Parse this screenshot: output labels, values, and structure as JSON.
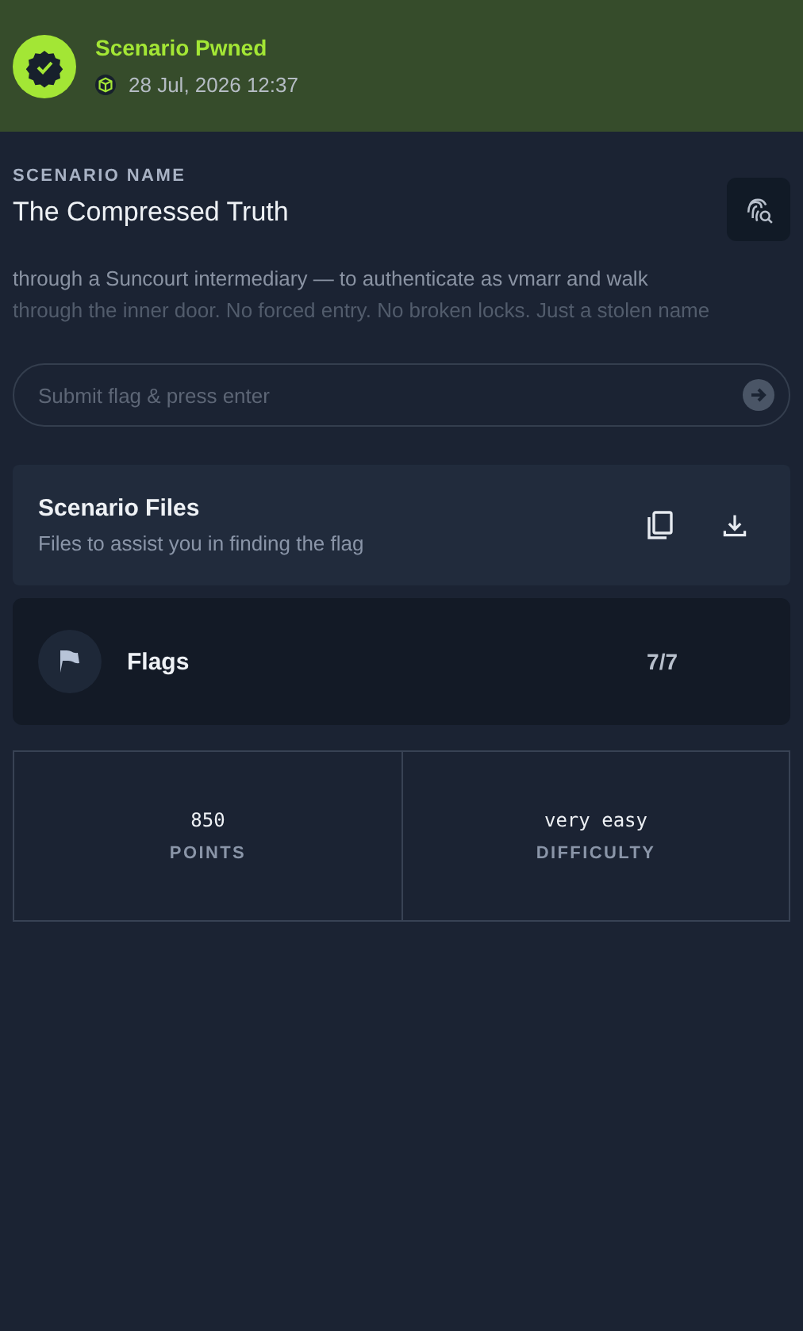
{
  "status_banner": {
    "title": "Scenario Pwned",
    "date": "28 Jul, 2026 12:37"
  },
  "scenario": {
    "label": "SCENARIO NAME",
    "name": "The Compressed Truth",
    "description_lines": [
      "through a Suncourt intermediary — to authenticate as vmarr and walk",
      "through the inner door. No forced entry. No broken locks. Just a stolen name"
    ]
  },
  "flag_input": {
    "placeholder": "Submit flag & press enter"
  },
  "files": {
    "title": "Scenario Files",
    "subtitle": "Files to assist you in finding the flag"
  },
  "flags": {
    "label": "Flags",
    "count": "7/7"
  },
  "stats": [
    {
      "value": "850",
      "label": "POINTS"
    },
    {
      "value": "very easy",
      "label": "DIFFICULTY"
    }
  ]
}
